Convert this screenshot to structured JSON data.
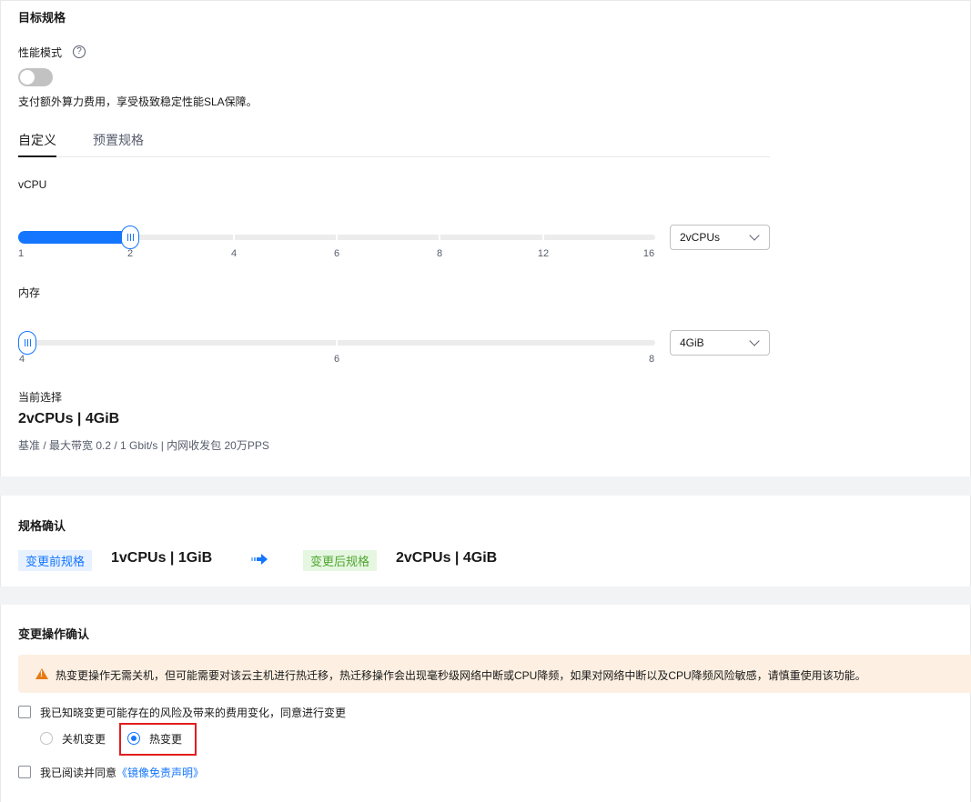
{
  "target_spec": {
    "title": "目标规格",
    "performance_mode_label": "性能模式",
    "help_icon_glyph": "?",
    "performance_mode_desc": "支付额外算力费用，享受极致稳定性能SLA保障。",
    "tabs": [
      {
        "label": "自定义",
        "active": true
      },
      {
        "label": "预置规格",
        "active": false
      }
    ],
    "vcpu": {
      "label": "vCPU",
      "ticks": [
        "1",
        "2",
        "4",
        "6",
        "8",
        "12",
        "16"
      ],
      "value": "2",
      "select_value": "2vCPUs"
    },
    "memory": {
      "label": "内存",
      "ticks": [
        "4",
        "6",
        "8"
      ],
      "value": "4",
      "select_value": "4GiB"
    },
    "current": {
      "label": "当前选择",
      "value": "2vCPUs | 4GiB",
      "detail": "基准 / 最大带宽  0.2 / 1 Gbit/s  |  内网收发包  20万PPS"
    }
  },
  "spec_confirm": {
    "title": "规格确认",
    "before_tag": "变更前规格",
    "before_value": "1vCPUs | 1GiB",
    "after_tag": "变更后规格",
    "after_value": "2vCPUs | 4GiB"
  },
  "change_confirm": {
    "title": "变更操作确认",
    "warning": "热变更操作无需关机，但可能需要对该云主机进行热迁移，热迁移操作会出现毫秒级网络中断或CPU降频，如果对网络中断以及CPU降频风险敏感，请慎重使用该功能。",
    "risk_checkbox_label": "我已知晓变更可能存在的风险及带来的费用变化，同意进行变更",
    "options": [
      {
        "label": "关机变更",
        "checked": false
      },
      {
        "label": "热变更",
        "checked": true
      }
    ],
    "agree_prefix": "我已阅读并同意",
    "agree_link": "《镜像免责声明》"
  },
  "colors": {
    "accent": "#1476ff",
    "warning_bg": "#fdf0e2",
    "highlight": "#e21d1d"
  }
}
